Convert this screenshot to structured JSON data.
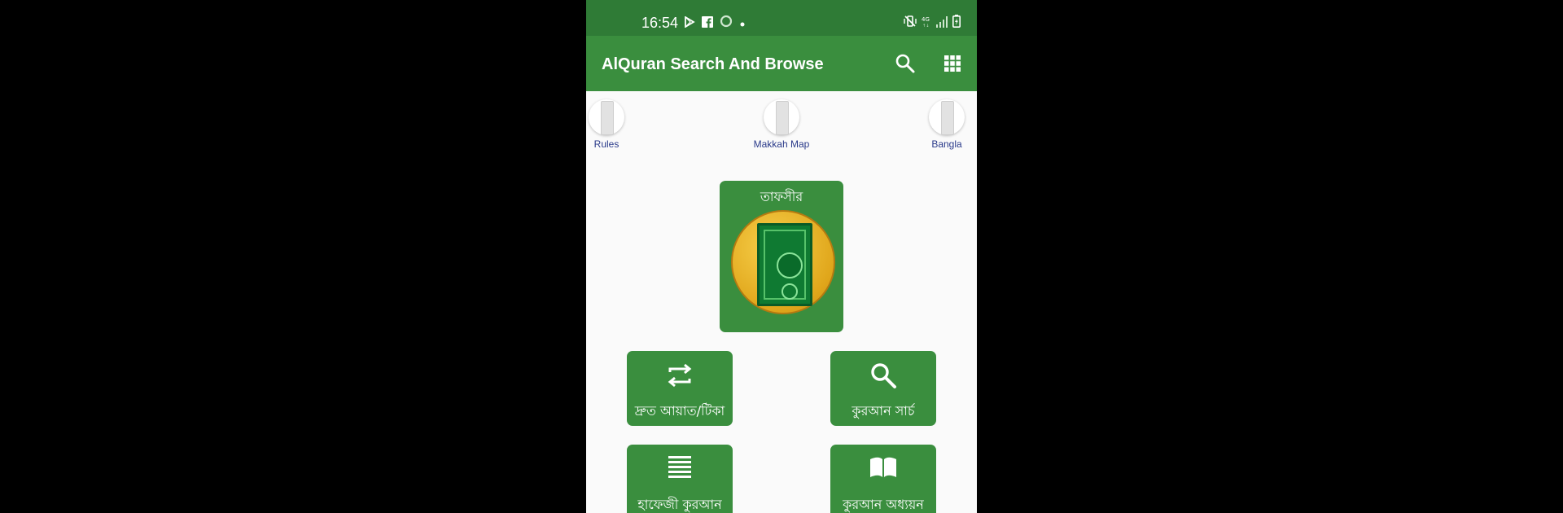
{
  "status_bar": {
    "time": "16:54",
    "left_icons": [
      "play-store-icon",
      "facebook-icon",
      "circle-icon",
      "dot-icon"
    ],
    "right_icons": [
      "mute-vibrate-icon",
      "4g-icon",
      "signal-icon",
      "battery-charging-icon"
    ]
  },
  "app_bar": {
    "title": "AlQuran Search And Browse",
    "actions": [
      "search-icon",
      "grid-icon"
    ]
  },
  "quick_links": [
    {
      "label": "Rules"
    },
    {
      "label": "Makkah Map"
    },
    {
      "label": "Bangla"
    }
  ],
  "feature_tile": {
    "label": "তাফসীর"
  },
  "tiles": [
    {
      "label": "দ্রুত আয়াত/টিকা",
      "icon": "repeat-icon"
    },
    {
      "label": "কুরআন সার্চ",
      "icon": "search-icon"
    },
    {
      "label": "হাফেজী কুরআন",
      "icon": "list-lines-icon"
    },
    {
      "label": "কুরআন অধ্যয়ন",
      "icon": "open-book-icon"
    }
  ],
  "colors": {
    "status_bar": "#2f7b36",
    "app_bar": "#3a8e3e",
    "tile": "#3a8e3e",
    "link_text": "#2a3a8a"
  }
}
